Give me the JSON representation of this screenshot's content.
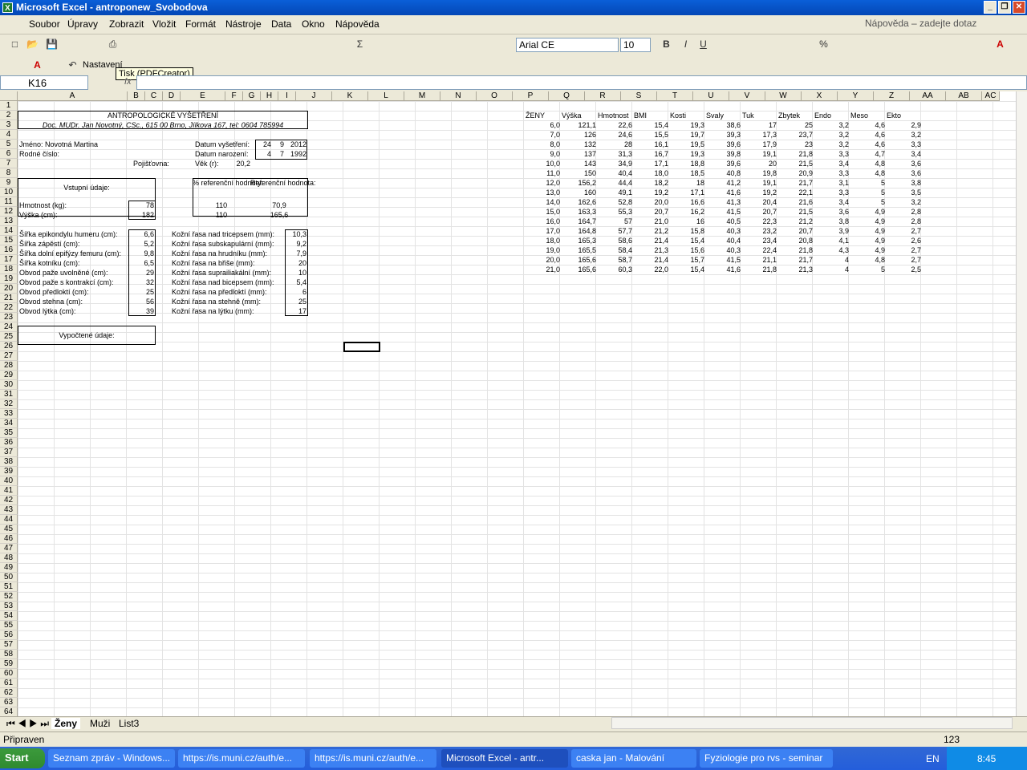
{
  "window": {
    "title": "Microsoft Excel - antroponew_Svobodova"
  },
  "menu": [
    "Soubor",
    "Úpravy",
    "Zobrazit",
    "Vložit",
    "Formát",
    "Nástroje",
    "Data",
    "Okno",
    "Nápověda"
  ],
  "help_placeholder": "Nápověda – zadejte dotaz",
  "toolbar": {
    "font": "Arial CE",
    "size": "10",
    "nastaveni": "Nastavení",
    "tooltip": "Tisk (PDFCreator)"
  },
  "namebox": "K16",
  "columns": [
    "A",
    "B",
    "C",
    "D",
    "E",
    "F",
    "G",
    "H",
    "I",
    "J",
    "K",
    "L",
    "M",
    "N",
    "O",
    "P",
    "Q",
    "R",
    "S",
    "T",
    "U",
    "V",
    "W",
    "X",
    "Y",
    "Z",
    "AA",
    "AB",
    "AC"
  ],
  "cells": {
    "title": "ANTROPOLOGICKÉ VYŠETŘENÍ",
    "doctor": "Doc. MUDr. Jan Novotný, CSc., 615 00 Brno, Jílkova 167, tel: 0604 785994",
    "jmeno": "Jméno: Novotná Martina",
    "rodne": "Rodné číslo:",
    "pojist": "Pojišťovna:",
    "datum_vys": "Datum vyšetření:",
    "dv_d": "24",
    "dv_m": "9",
    "dv_y": "2012",
    "datum_nar": "Datum narození:",
    "dn_d": "4",
    "dn_m": "7",
    "dn_y": "1992",
    "vek": "Věk (r):",
    "vek_v": "20,2",
    "vstupni": "Vstupní údaje:",
    "pct_ref": "% referenční hodnoty:",
    "ref_h": "Referenční hodnota:",
    "hmotnost": "Hmotnost (kg):",
    "hm_v": "78",
    "hm_p": "110",
    "hm_r": "70,9",
    "vyska": "Výška (cm):",
    "vy_v": "182",
    "vy_p": "110",
    "vy_r": "165,6",
    "vypoctene": "Vypočtené údaje:"
  },
  "body_rows": [
    [
      "Šířka epikondylu humeru (cm):",
      "6,6",
      "Kožní řasa nad tricepsem (mm):",
      "10,3"
    ],
    [
      "Šířka zápěstí (cm):",
      "5,2",
      "Kožní řasa subskapulární (mm):",
      "9,2"
    ],
    [
      "Šířka dolní epifýzy femuru (cm):",
      "9,8",
      "Kožní řasa na hrudníku (mm):",
      "7,9"
    ],
    [
      "Šířka kotníku (cm):",
      "6,5",
      "Kožní řasa na břiše (mm):",
      "20"
    ],
    [
      "Obvod paže uvolněné (cm):",
      "29",
      "Kožní řasa suprailiakální (mm):",
      "10"
    ],
    [
      "Obvod paže s kontrakcí (cm):",
      "32",
      "Kožní řasa nad bicepsem (mm):",
      "5,4"
    ],
    [
      "Obvod předloktí (cm):",
      "25",
      "Kožní řasa na předloktí (mm):",
      "6"
    ],
    [
      "Obvod stehna (cm):",
      "56",
      "Kožní řasa na stehně (mm):",
      "25"
    ],
    [
      "Obvod lýtka (cm):",
      "39",
      "Kožní řasa na lýtku (mm):",
      "17"
    ]
  ],
  "zeny_header": [
    "ŽENY",
    "Výška",
    "Hmotnost",
    "BMI",
    "Kosti",
    "Svaly",
    "Tuk",
    "Zbytek",
    "Endo",
    "Meso",
    "Ekto"
  ],
  "zeny_rows": [
    [
      "6,0",
      "121,1",
      "22,6",
      "15,4",
      "19,3",
      "38,6",
      "17",
      "25",
      "3,2",
      "4,6",
      "2,9"
    ],
    [
      "7,0",
      "126",
      "24,6",
      "15,5",
      "19,7",
      "39,3",
      "17,3",
      "23,7",
      "3,2",
      "4,6",
      "3,2"
    ],
    [
      "8,0",
      "132",
      "28",
      "16,1",
      "19,5",
      "39,6",
      "17,9",
      "23",
      "3,2",
      "4,6",
      "3,3"
    ],
    [
      "9,0",
      "137",
      "31,3",
      "16,7",
      "19,3",
      "39,8",
      "19,1",
      "21,8",
      "3,3",
      "4,7",
      "3,4"
    ],
    [
      "10,0",
      "143",
      "34,9",
      "17,1",
      "18,8",
      "39,6",
      "20",
      "21,5",
      "3,4",
      "4,8",
      "3,6"
    ],
    [
      "11,0",
      "150",
      "40,4",
      "18,0",
      "18,5",
      "40,8",
      "19,8",
      "20,9",
      "3,3",
      "4,8",
      "3,6"
    ],
    [
      "12,0",
      "156,2",
      "44,4",
      "18,2",
      "18",
      "41,2",
      "19,1",
      "21,7",
      "3,1",
      "5",
      "3,8"
    ],
    [
      "13,0",
      "160",
      "49,1",
      "19,2",
      "17,1",
      "41,6",
      "19,2",
      "22,1",
      "3,3",
      "5",
      "3,5"
    ],
    [
      "14,0",
      "162,6",
      "52,8",
      "20,0",
      "16,6",
      "41,3",
      "20,4",
      "21,6",
      "3,4",
      "5",
      "3,2"
    ],
    [
      "15,0",
      "163,3",
      "55,3",
      "20,7",
      "16,2",
      "41,5",
      "20,7",
      "21,5",
      "3,6",
      "4,9",
      "2,8"
    ],
    [
      "16,0",
      "164,7",
      "57",
      "21,0",
      "16",
      "40,5",
      "22,3",
      "21,2",
      "3,8",
      "4,9",
      "2,8"
    ],
    [
      "17,0",
      "164,8",
      "57,7",
      "21,2",
      "15,8",
      "40,3",
      "23,2",
      "20,7",
      "3,9",
      "4,9",
      "2,7"
    ],
    [
      "18,0",
      "165,3",
      "58,6",
      "21,4",
      "15,4",
      "40,4",
      "23,4",
      "20,8",
      "4,1",
      "4,9",
      "2,6"
    ],
    [
      "19,0",
      "165,5",
      "58,4",
      "21,3",
      "15,6",
      "40,3",
      "22,4",
      "21,8",
      "4,3",
      "4,9",
      "2,7"
    ],
    [
      "20,0",
      "165,6",
      "58,7",
      "21,4",
      "15,7",
      "41,5",
      "21,1",
      "21,7",
      "4",
      "4,8",
      "2,7"
    ],
    [
      "21,0",
      "165,6",
      "60,3",
      "22,0",
      "15,4",
      "41,6",
      "21,8",
      "21,3",
      "4",
      "5",
      "2,5"
    ]
  ],
  "tabs": [
    "Ženy",
    "Muži",
    "List3"
  ],
  "status": {
    "left": "Připraven",
    "right": "123"
  },
  "taskbar": {
    "start": "Start",
    "items": [
      "Seznam zpráv - Windows...",
      "https://is.muni.cz/auth/e...",
      "https://is.muni.cz/auth/e...",
      "Microsoft Excel - antr...",
      "caska jan - Malování",
      "Fyziologie pro rvs - seminar"
    ],
    "lang": "EN",
    "clock": "8:45"
  }
}
